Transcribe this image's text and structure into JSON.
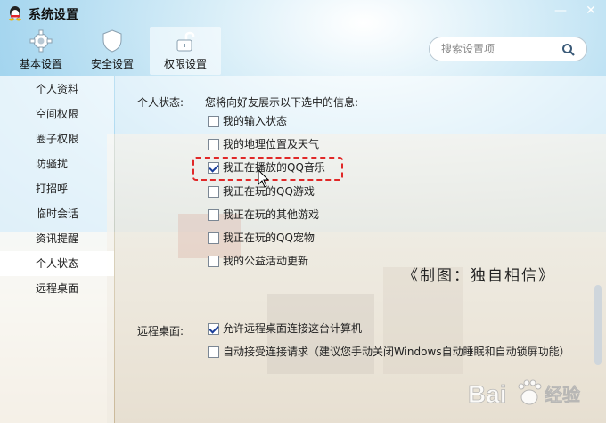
{
  "window": {
    "title": "系统设置",
    "minimize_glyph": "—",
    "close_glyph": "✕"
  },
  "tabs": [
    {
      "label": "基本设置",
      "icon": "gear-icon",
      "active": false
    },
    {
      "label": "安全设置",
      "icon": "shield-icon",
      "active": false
    },
    {
      "label": "权限设置",
      "icon": "unlock-icon",
      "active": true
    }
  ],
  "search": {
    "placeholder": "搜索设置项"
  },
  "sidebar": {
    "items": [
      {
        "label": "个人资料"
      },
      {
        "label": "空间权限"
      },
      {
        "label": "圈子权限"
      },
      {
        "label": "防骚扰"
      },
      {
        "label": "打招呼"
      },
      {
        "label": "临时会话"
      },
      {
        "label": "资讯提醒"
      },
      {
        "label": "个人状态",
        "active": true
      },
      {
        "label": "远程桌面"
      }
    ]
  },
  "personal_status": {
    "label": "个人状态:",
    "description": "您将向好友展示以下选中的信息:",
    "options": [
      {
        "label": "我的输入状态",
        "checked": false
      },
      {
        "label": "我的地理位置及天气",
        "checked": false
      },
      {
        "label": "我正在播放的QQ音乐",
        "checked": true
      },
      {
        "label": "我正在玩的QQ游戏",
        "checked": false
      },
      {
        "label": "我正在玩的其他游戏",
        "checked": false
      },
      {
        "label": "我正在玩的QQ宠物",
        "checked": false
      },
      {
        "label": "我的公益活动更新",
        "checked": false
      }
    ]
  },
  "remote_desktop": {
    "label": "远程桌面:",
    "options": [
      {
        "label": "允许远程桌面连接这台计算机",
        "checked": true
      },
      {
        "label": "自动接受连接请求（建议您手动关闭Windows自动睡眠和自动锁屏功能）",
        "checked": false
      }
    ]
  },
  "watermark": {
    "caption": "《制图：独自相信》",
    "brand": "Bai",
    "brand_suffix": "经验"
  },
  "colors": {
    "highlight": "#e02828",
    "check": "#1a3e9a"
  }
}
